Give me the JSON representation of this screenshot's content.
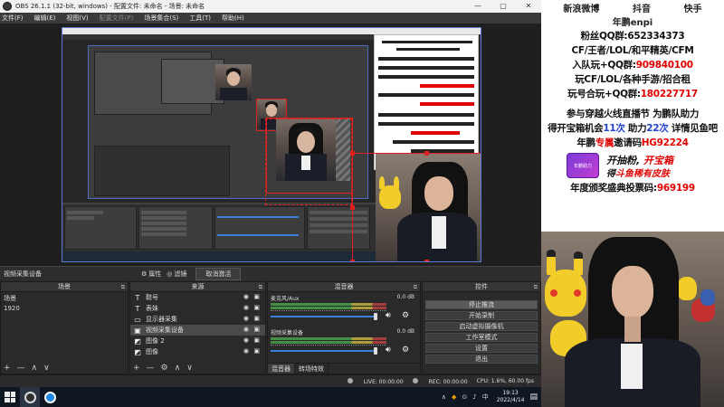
{
  "window": {
    "title": "OBS 26.1.1 (32-bit, windows) - 配置文件: 未命名 - 场景: 未命名",
    "controls": [
      "—",
      "▢",
      "✕"
    ]
  },
  "menu": [
    "文件(F)",
    "编辑(E)",
    "视图(V)",
    "配置文件(P)",
    "场景集合(S)",
    "工具(T)",
    "帮助(H)"
  ],
  "source_toolbar": {
    "selected_source": "视频采集设备",
    "properties_label": "属性",
    "filters_label": "滤镜",
    "deactivate_label": "取消激活"
  },
  "scenes": {
    "title": "场景",
    "items": [
      "场景",
      "1920"
    ],
    "footer": [
      "+",
      "—",
      "∧",
      "∨"
    ]
  },
  "sources": {
    "title": "来源",
    "items": [
      {
        "icon": "text-icon",
        "glyph": "T",
        "label": "鞋号"
      },
      {
        "icon": "text-icon",
        "glyph": "T",
        "label": "表妹"
      },
      {
        "icon": "monitor-icon",
        "glyph": "▭",
        "label": "显示器采集"
      },
      {
        "icon": "camera-icon",
        "glyph": "▣",
        "label": "视频采集设备"
      },
      {
        "icon": "image-icon",
        "glyph": "◩",
        "label": "图像 2"
      },
      {
        "icon": "image-icon",
        "glyph": "◩",
        "label": "图像"
      }
    ],
    "footer": [
      "+",
      "—",
      "⚙",
      "∧",
      "∨"
    ]
  },
  "mixer": {
    "title": "混音器",
    "channels": [
      {
        "name": "麦克风/Aux",
        "db": "0.0 dB"
      },
      {
        "name": "视频采集设备",
        "db": "0.0 dB"
      }
    ],
    "tabs": [
      "混音器",
      "转场特效"
    ]
  },
  "controls": {
    "title": "控件",
    "buttons": [
      "停止推流",
      "开始录制",
      "启动虚拟摄像机",
      "工作室模式",
      "设置",
      "退出"
    ]
  },
  "status": {
    "live": "LIVE: 00:00:00",
    "rec": "REC: 00:00:00",
    "cpu": "CPU: 1.6%, 60.00 fps"
  },
  "taskbar": {
    "time": "19:13",
    "date": "2022/4/14",
    "ime": "中",
    "tray": [
      "∧",
      "◆",
      "⊙",
      "♪",
      "中"
    ]
  },
  "overlay": {
    "platforms": [
      "新浪微博",
      "抖音",
      "快手"
    ],
    "nickname": "年鹏enpi",
    "fan_qq": {
      "label": "粉丝QQ群:",
      "value": "652334373"
    },
    "games": "CF/王者/LOL/和平精英/CFM",
    "join_team": {
      "label": "入队玩+QQ群:",
      "value": "909840100"
    },
    "play": "玩CF/LOL/各种手游/招合租",
    "pair": {
      "label": "玩号合玩+QQ群:",
      "value": "180227717"
    },
    "event1": "参与穿越火线直播节 为鹏队助力",
    "event2": {
      "pre": "得开宝箱机会",
      "n1": "11次",
      "mid": " 助力",
      "n2": "22次",
      "post": " 详情见鱼吧"
    },
    "invite": {
      "label": "年鹏",
      "mid": "专属",
      "post": "邀请码",
      "code": "HG92224"
    },
    "promo": {
      "badge": "年鹏助力",
      "l1_pre": "开抽粉, ",
      "l1_post": "开宝箱",
      "l2_pre": "得",
      "l2_red": "斗鱼稀有皮肤"
    },
    "vote": {
      "label": "年度颁奖盛典投票码:",
      "code": "969199"
    }
  },
  "colors": {
    "red": "#e00000",
    "blue": "#2244cc",
    "selection": "#e02020",
    "preview_border": "#5b7bd5"
  }
}
